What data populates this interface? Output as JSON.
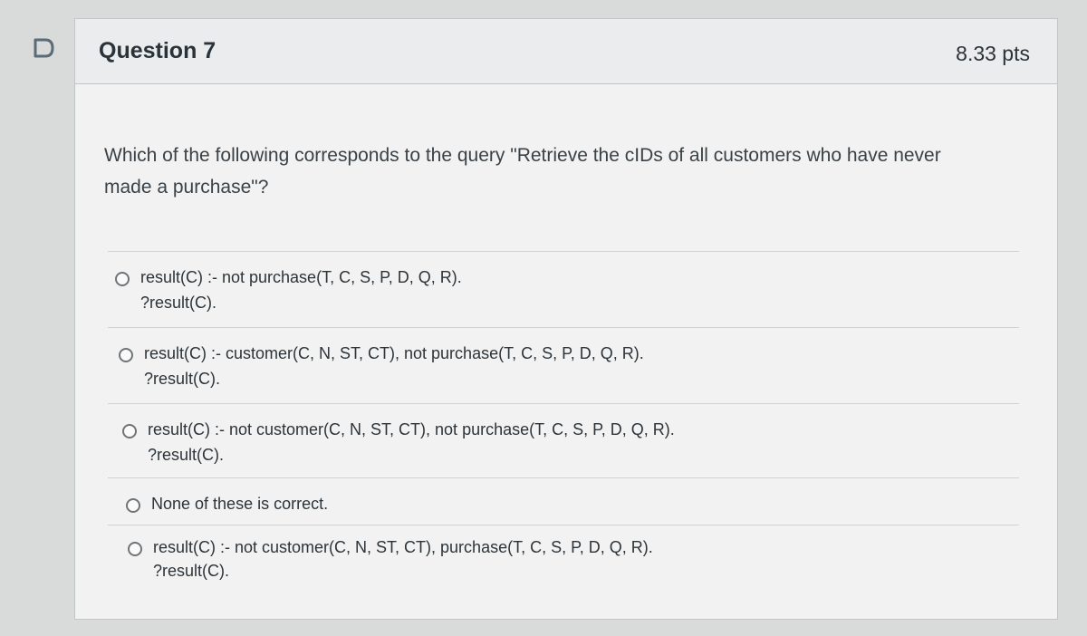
{
  "question": {
    "title": "Question 7",
    "points": "8.33 pts",
    "text": "Which of the following corresponds to the query \"Retrieve the cIDs of all customers who have never made a purchase\"?"
  },
  "answers": [
    {
      "line1": "result(C) :- not purchase(T, C, S, P, D, Q, R).",
      "line2": "?result(C)."
    },
    {
      "line1": "result(C) :- customer(C, N, ST, CT), not purchase(T, C, S, P, D, Q, R).",
      "line2": "?result(C)."
    },
    {
      "line1": "result(C) :- not customer(C, N, ST, CT), not purchase(T, C, S, P, D, Q, R).",
      "line2": "?result(C)."
    },
    {
      "line1": "None of these is correct.",
      "line2": ""
    },
    {
      "line1": "result(C) :- not customer(C, N, ST, CT), purchase(T, C, S, P, D, Q, R).",
      "line2": "?result(C)."
    }
  ],
  "icons": {
    "flag": "bookmark-flag-icon",
    "radio": "radio-button-icon"
  },
  "colors": {
    "flag": "#5b6b78",
    "text": "#2d3b45"
  }
}
